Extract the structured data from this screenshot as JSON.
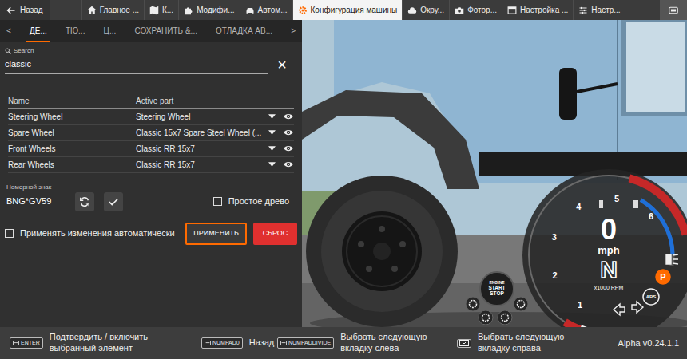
{
  "back": {
    "label": "Назад"
  },
  "tabs": [
    {
      "label": "Главное ...",
      "selected": false
    },
    {
      "label": "К...",
      "selected": false
    },
    {
      "label": "Модифи...",
      "selected": false
    },
    {
      "label": "Автом...",
      "selected": false
    },
    {
      "label": "Конфигурация машины",
      "selected": true
    },
    {
      "label": "Окру...",
      "selected": false
    },
    {
      "label": "Фотор...",
      "selected": false
    },
    {
      "label": "Настройка ...",
      "selected": false
    },
    {
      "label": "Настр...",
      "selected": false
    }
  ],
  "subtabs": {
    "prev": "<",
    "next": ">",
    "items": [
      {
        "label": "ДЕ...",
        "selected": true
      },
      {
        "label": "ТЮ...",
        "selected": false
      },
      {
        "label": "Ц...",
        "selected": false
      },
      {
        "label": "СОХРАНИТЬ &...",
        "selected": false
      },
      {
        "label": "ОТЛАДКА АВ...",
        "selected": false
      }
    ]
  },
  "search": {
    "label": "Search",
    "value": "classic",
    "clear": "×"
  },
  "parts": {
    "columns": [
      "Name",
      "Active part"
    ],
    "rows": [
      {
        "name": "Steering Wheel",
        "part": "Steering Wheel",
        "visible": true
      },
      {
        "name": "Spare Wheel",
        "part": "Classic 15x7 Spare Steel Wheel (...",
        "visible": true
      },
      {
        "name": "Front Wheels",
        "part": "Classic RR 15x7",
        "visible": true
      },
      {
        "name": "Rear Wheels",
        "part": "Classic RR 15x7",
        "visible": true
      }
    ]
  },
  "plate": {
    "label": "Номерной знак",
    "value": "BNG*GV59"
  },
  "simple_tree": {
    "label": "Простое древо",
    "checked": false
  },
  "auto_apply": {
    "label": "Применять изменения автоматически",
    "checked": false
  },
  "buttons": [
    {
      "label": "ПРИМЕНИТЬ",
      "kind": "apply",
      "focused": true
    },
    {
      "label": "СБРОС",
      "kind": "reset",
      "focused": false
    }
  ],
  "hud": {
    "speed": "0",
    "unit": "mph",
    "gear": "N",
    "rpm_label": "x1000 RPM",
    "ticks": [
      "1",
      "2",
      "3",
      "4",
      "5",
      "6"
    ],
    "rpm_level": 0.12,
    "fuel_level": 0.85,
    "start_stop": [
      "ENGINE",
      "START",
      "STOP"
    ],
    "indicators": [
      {
        "label": "P",
        "on": true
      },
      {
        "label": "ABS",
        "on": false
      }
    ]
  },
  "hints": [
    {
      "kind": "key",
      "key": "ENTER",
      "text": "Подтвердить / включить выбранный элемент"
    },
    {
      "kind": "key",
      "key": "NUMPAD0",
      "text": "Назад"
    },
    {
      "kind": "key",
      "key": "NUMPADDIVIDE",
      "text": "Выбрать следующую вкладку слева"
    },
    {
      "kind": "icon",
      "text": "Выбрать следующую вкладку справа"
    }
  ],
  "version": "Alpha v0.24.1.1"
}
